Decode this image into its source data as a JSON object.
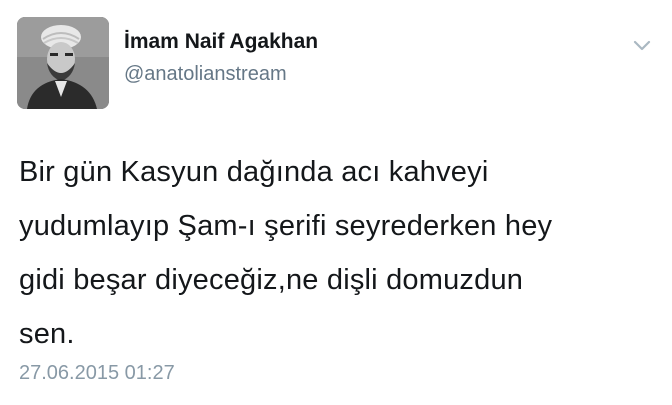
{
  "user": {
    "display_name": "İmam Naif Agakhan",
    "handle": "@anatolianstream",
    "avatar_icon": "portrait-photo"
  },
  "menu": {
    "icon": "chevron-down-icon"
  },
  "tweet": {
    "lines": [
      "Bir gün Kasyun dağında acı kahveyi",
      "yudumlayıp Şam-ı şerifi seyrederken hey",
      "gidi beşar diyeceğiz,ne dişli domuzdun",
      "sen."
    ],
    "timestamp": "27.06.2015 01:27"
  },
  "colors": {
    "text_primary": "#14171a",
    "text_secondary": "#657786",
    "timestamp": "#8899a6",
    "chevron": "#aab8c2"
  }
}
